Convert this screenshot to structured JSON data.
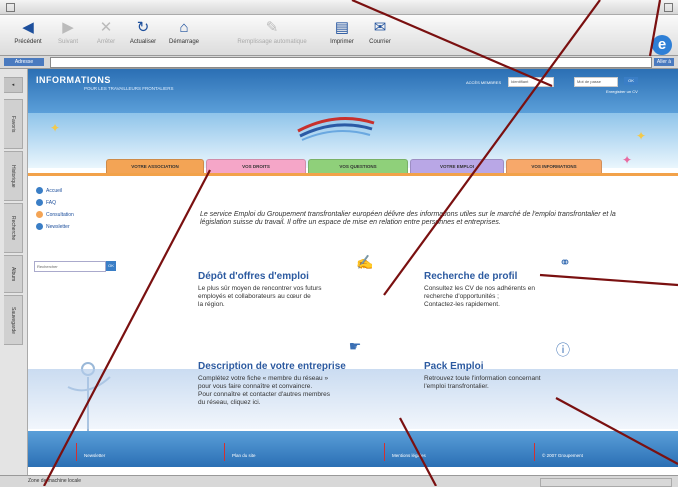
{
  "browser": {
    "toolbar": [
      {
        "label": "Précédent",
        "icon": "back-arrow-icon",
        "enabled": true
      },
      {
        "label": "Suivant",
        "icon": "forward-arrow-icon",
        "enabled": false
      },
      {
        "label": "Arrêter",
        "icon": "stop-icon",
        "enabled": false
      },
      {
        "label": "Actualiser",
        "icon": "refresh-icon",
        "enabled": true
      },
      {
        "label": "Démarrage",
        "icon": "home-icon",
        "enabled": true
      },
      {
        "label": "Remplissage automatique",
        "icon": "autofill-icon",
        "enabled": false
      },
      {
        "label": "Imprimer",
        "icon": "print-icon",
        "enabled": true
      },
      {
        "label": "Courrier",
        "icon": "mail-icon",
        "enabled": true
      }
    ],
    "address_label": "Adresse",
    "go_label": "Aller à",
    "explorer_tabs": [
      "Favoris",
      "Historique",
      "Recherche",
      "Album",
      "Sauvegarde"
    ],
    "status_text": "Zone de machine locale"
  },
  "site": {
    "title": "INFORMATIONS",
    "subtitle": "POUR LES TRAVAILLEURS FRONTALIERS",
    "access_label": "ACCÈS MEMBRES",
    "access_placeholder": "Identifiant",
    "lang_value": "Mot de passe",
    "ok_label": "OK",
    "small_link": "Enregistrer un CV",
    "nav_tabs": [
      {
        "label": "VOTRE ASSOCIATION",
        "color": "#f3a455"
      },
      {
        "label": "VOS DROITS",
        "color": "#f5a6c8"
      },
      {
        "label": "VOS QUESTIONS",
        "color": "#8fd07a"
      },
      {
        "label": "VOTRE EMPLOI",
        "color": "#b9a7e6"
      },
      {
        "label": "VOS INFORMATIONS",
        "color": "#f7a86a"
      }
    ],
    "sidebar_items": [
      {
        "label": "Accueil",
        "color": "#3a7ec6"
      },
      {
        "label": "FAQ",
        "color": "#3a7ec6"
      },
      {
        "label": "Consultation",
        "color": "#f3a455"
      },
      {
        "label": "Newsletter",
        "color": "#3a7ec6"
      }
    ],
    "side_search_placeholder": "Rechercher",
    "side_go": "OK",
    "intro": "Le service Emploi du Groupement transfrontalier européen délivre des informations utiles sur le marché de l'emploi transfrontalier et la législation suisse du travail. Il offre un espace de mise en relation entre personnes et entreprises.",
    "blocks": [
      {
        "title": "Dépôt d'offres d'emploi",
        "text": [
          "Le plus sûr moyen de rencontrer vos futurs",
          "employés et collaborateurs au cœur de",
          "la région."
        ],
        "icon": "pen-icon"
      },
      {
        "title": "Recherche de profil",
        "text": [
          "Consultez les CV de nos adhérents en",
          "recherche d'opportunités ;",
          "Contactez-les rapidement."
        ],
        "icon": "binoculars-icon"
      },
      {
        "title": "Description de votre entreprise",
        "text": [
          "Complétez votre fiche « membre du réseau »",
          "pour vous faire connaître et convaincre.",
          "Pour connaître et contacter d'autres membres",
          "du réseau, cliquez ici."
        ],
        "icon": "hand-icon"
      },
      {
        "title": "Pack Emploi",
        "text": [
          "Retrouvez toute l'information concernant",
          "l'emploi transfrontalier."
        ],
        "icon": "info-icon"
      }
    ],
    "footer_items": [
      "Newsletter",
      "Plan du site",
      "Mentions légales",
      "© 2007 Groupement"
    ]
  }
}
